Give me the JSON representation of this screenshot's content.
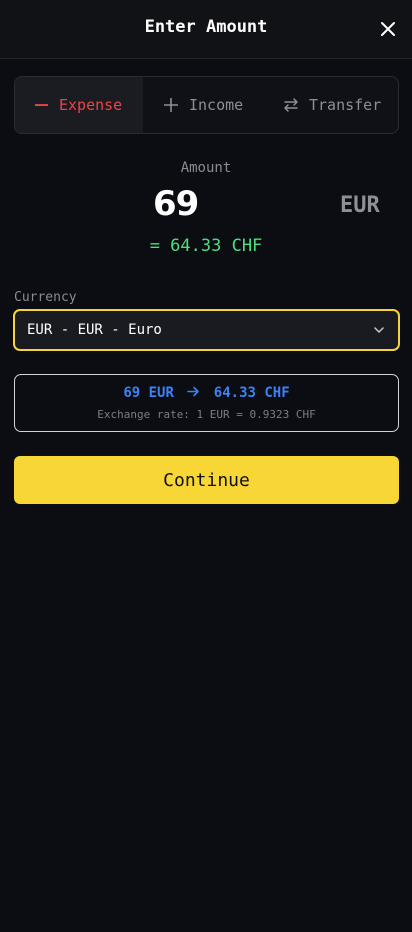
{
  "header": {
    "title": "Enter Amount"
  },
  "tabs": [
    {
      "label": "Expense",
      "icon": "minus-icon",
      "active": true
    },
    {
      "label": "Income",
      "icon": "plus-icon",
      "active": false
    },
    {
      "label": "Transfer",
      "icon": "swap-arrows-icon",
      "active": false
    }
  ],
  "amount": {
    "label": "Amount",
    "value": "69",
    "currency": "EUR",
    "converted": "= 64.33 CHF"
  },
  "currency": {
    "label": "Currency",
    "selected": "EUR - EUR - Euro"
  },
  "rate": {
    "from": "69 EUR",
    "to": "64.33 CHF",
    "description": "Exchange rate: 1 EUR = 0.9323 CHF"
  },
  "actions": {
    "continue_label": "Continue"
  },
  "colors": {
    "accent": "#f7d635",
    "expense": "#ef4444",
    "converted": "#4ade80",
    "rate": "#3b82f6",
    "background": "#0c0d12"
  }
}
